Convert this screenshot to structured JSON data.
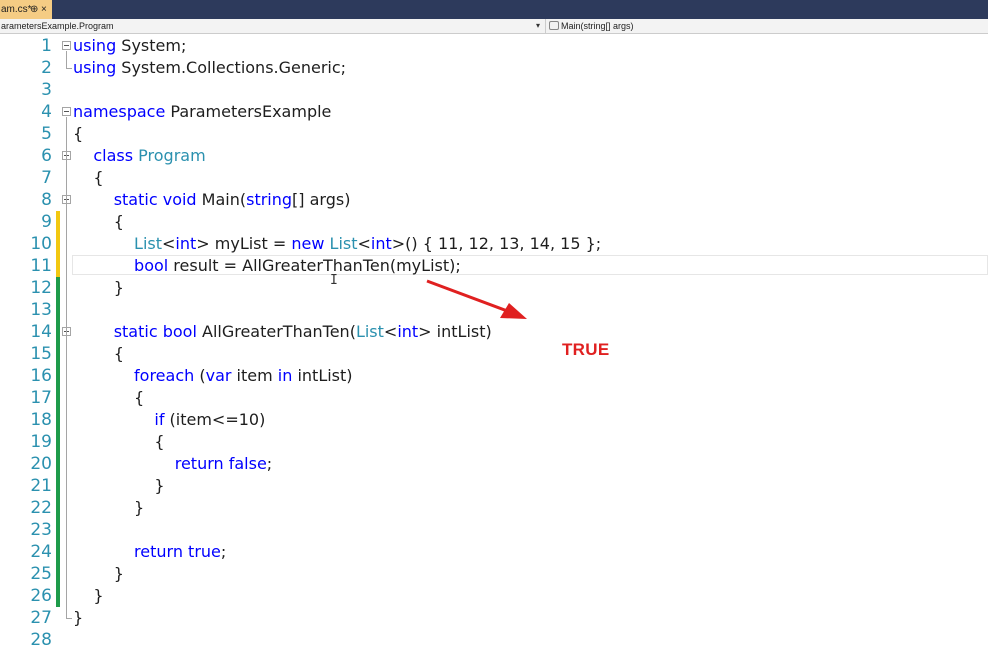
{
  "tab": {
    "title": "am.cs*",
    "pin": "⊕",
    "close": "×"
  },
  "nav": {
    "left": "arametersExample.Program",
    "right": "Main(string[] args)"
  },
  "lines": [
    {
      "n": "1",
      "tokens": [
        {
          "t": "using",
          "c": "kw"
        },
        {
          "t": " System;",
          "c": ""
        }
      ]
    },
    {
      "n": "2",
      "tokens": [
        {
          "t": "using",
          "c": "kw"
        },
        {
          "t": " System.Collections.Generic;",
          "c": ""
        }
      ]
    },
    {
      "n": "3",
      "tokens": []
    },
    {
      "n": "4",
      "tokens": [
        {
          "t": "namespace",
          "c": "kw"
        },
        {
          "t": " ParametersExample",
          "c": ""
        }
      ]
    },
    {
      "n": "5",
      "tokens": [
        {
          "t": "{",
          "c": ""
        }
      ]
    },
    {
      "n": "6",
      "tokens": [
        {
          "t": "    ",
          "c": ""
        },
        {
          "t": "class",
          "c": "kw"
        },
        {
          "t": " ",
          "c": ""
        },
        {
          "t": "Program",
          "c": "ty"
        }
      ]
    },
    {
      "n": "7",
      "tokens": [
        {
          "t": "    {",
          "c": ""
        }
      ]
    },
    {
      "n": "8",
      "tokens": [
        {
          "t": "        ",
          "c": ""
        },
        {
          "t": "static",
          "c": "kw"
        },
        {
          "t": " ",
          "c": ""
        },
        {
          "t": "void",
          "c": "kw"
        },
        {
          "t": " Main(",
          "c": ""
        },
        {
          "t": "string",
          "c": "kw"
        },
        {
          "t": "[] args)",
          "c": ""
        }
      ]
    },
    {
      "n": "9",
      "tokens": [
        {
          "t": "        {",
          "c": ""
        }
      ]
    },
    {
      "n": "10",
      "tokens": [
        {
          "t": "            ",
          "c": ""
        },
        {
          "t": "List",
          "c": "ty"
        },
        {
          "t": "<",
          "c": ""
        },
        {
          "t": "int",
          "c": "kw"
        },
        {
          "t": "> myList = ",
          "c": ""
        },
        {
          "t": "new",
          "c": "kw"
        },
        {
          "t": " ",
          "c": ""
        },
        {
          "t": "List",
          "c": "ty"
        },
        {
          "t": "<",
          "c": ""
        },
        {
          "t": "int",
          "c": "kw"
        },
        {
          "t": ">() { 11, 12, 13, 14, 15 };",
          "c": ""
        }
      ]
    },
    {
      "n": "11",
      "tokens": [
        {
          "t": "            ",
          "c": ""
        },
        {
          "t": "bool",
          "c": "kw"
        },
        {
          "t": " result = AllGreaterThanTen(myList);",
          "c": ""
        }
      ]
    },
    {
      "n": "12",
      "tokens": [
        {
          "t": "        }",
          "c": ""
        }
      ]
    },
    {
      "n": "13",
      "tokens": []
    },
    {
      "n": "14",
      "tokens": [
        {
          "t": "        ",
          "c": ""
        },
        {
          "t": "static",
          "c": "kw"
        },
        {
          "t": " ",
          "c": ""
        },
        {
          "t": "bool",
          "c": "kw"
        },
        {
          "t": " AllGreaterThanTen(",
          "c": ""
        },
        {
          "t": "List",
          "c": "ty"
        },
        {
          "t": "<",
          "c": ""
        },
        {
          "t": "int",
          "c": "kw"
        },
        {
          "t": "> intList)",
          "c": ""
        }
      ]
    },
    {
      "n": "15",
      "tokens": [
        {
          "t": "        {",
          "c": ""
        }
      ]
    },
    {
      "n": "16",
      "tokens": [
        {
          "t": "            ",
          "c": ""
        },
        {
          "t": "foreach",
          "c": "kw"
        },
        {
          "t": " (",
          "c": ""
        },
        {
          "t": "var",
          "c": "kw"
        },
        {
          "t": " item ",
          "c": ""
        },
        {
          "t": "in",
          "c": "kw"
        },
        {
          "t": " intList)",
          "c": ""
        }
      ]
    },
    {
      "n": "17",
      "tokens": [
        {
          "t": "            {",
          "c": ""
        }
      ]
    },
    {
      "n": "18",
      "tokens": [
        {
          "t": "                ",
          "c": ""
        },
        {
          "t": "if",
          "c": "kw"
        },
        {
          "t": " (item<=10)",
          "c": ""
        }
      ]
    },
    {
      "n": "19",
      "tokens": [
        {
          "t": "                {",
          "c": ""
        }
      ]
    },
    {
      "n": "20",
      "tokens": [
        {
          "t": "                    ",
          "c": ""
        },
        {
          "t": "return",
          "c": "kw"
        },
        {
          "t": " ",
          "c": ""
        },
        {
          "t": "false",
          "c": "kw"
        },
        {
          "t": ";",
          "c": ""
        }
      ]
    },
    {
      "n": "21",
      "tokens": [
        {
          "t": "                }",
          "c": ""
        }
      ]
    },
    {
      "n": "22",
      "tokens": [
        {
          "t": "            }",
          "c": ""
        }
      ]
    },
    {
      "n": "23",
      "tokens": []
    },
    {
      "n": "24",
      "tokens": [
        {
          "t": "            ",
          "c": ""
        },
        {
          "t": "return",
          "c": "kw"
        },
        {
          "t": " ",
          "c": ""
        },
        {
          "t": "true",
          "c": "kw"
        },
        {
          "t": ";",
          "c": ""
        }
      ]
    },
    {
      "n": "25",
      "tokens": [
        {
          "t": "        }",
          "c": ""
        }
      ]
    },
    {
      "n": "26",
      "tokens": [
        {
          "t": "    }",
          "c": ""
        }
      ]
    },
    {
      "n": "27",
      "tokens": [
        {
          "t": "}",
          "c": ""
        }
      ]
    },
    {
      "n": "28",
      "tokens": []
    }
  ],
  "change_bars": {
    "9": "#f2c811",
    "10": "#f2c811",
    "11": "#f2c811",
    "12": "#1e9b4a",
    "13": "#1e9b4a",
    "14": "#1e9b4a",
    "15": "#1e9b4a",
    "16": "#1e9b4a",
    "17": "#1e9b4a",
    "18": "#1e9b4a",
    "19": "#1e9b4a",
    "20": "#1e9b4a",
    "21": "#1e9b4a",
    "22": "#1e9b4a",
    "23": "#1e9b4a",
    "24": "#1e9b4a",
    "25": "#1e9b4a",
    "26": "#1e9b4a"
  },
  "folds": [
    "1",
    "4",
    "6",
    "8",
    "14"
  ],
  "current_line": "11",
  "annotation": {
    "text": "TRUE",
    "color": "#e02020"
  },
  "colors": {
    "keyword": "#0000ff",
    "type": "#2b91af",
    "line_number": "#2b91af",
    "tab_active": "#f5cc84",
    "title_bar": "#2d3a5c"
  }
}
